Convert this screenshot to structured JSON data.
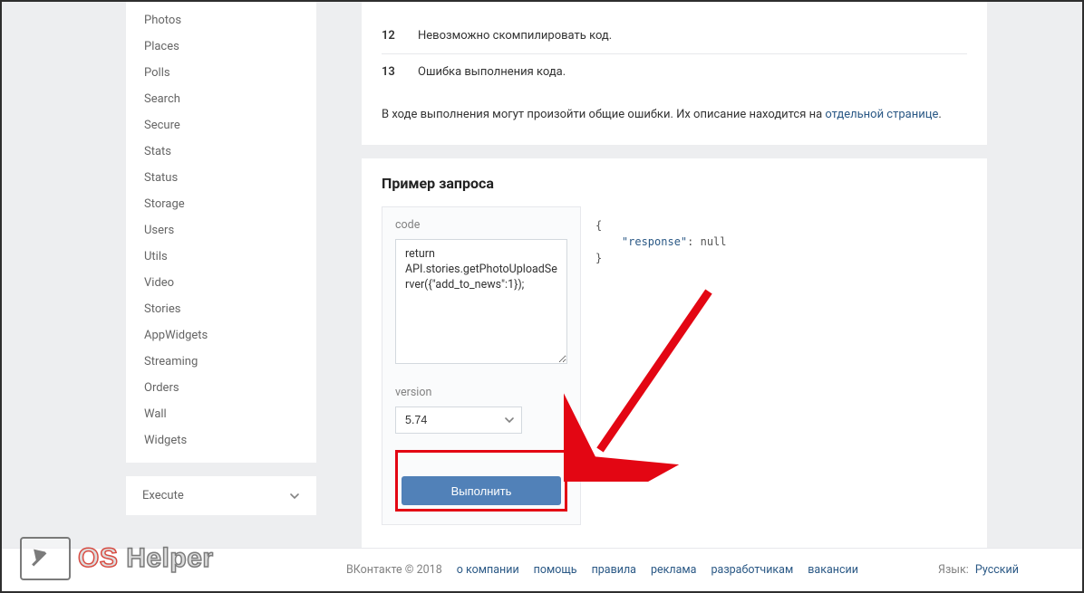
{
  "sidebar": {
    "items": [
      "Photos",
      "Places",
      "Polls",
      "Search",
      "Secure",
      "Stats",
      "Status",
      "Storage",
      "Users",
      "Utils",
      "Video",
      "Stories",
      "AppWidgets",
      "Streaming",
      "Orders",
      "Wall",
      "Widgets"
    ],
    "execute_label": "Execute"
  },
  "errors": {
    "rows": [
      {
        "code": "12",
        "msg": "Невозможно скомпилировать код."
      },
      {
        "code": "13",
        "msg": "Ошибка выполнения кода."
      }
    ],
    "note_prefix": "В ходе выполнения могут произойти общие ошибки. Их описание находится на ",
    "note_link": "отдельной странице",
    "note_suffix": "."
  },
  "example": {
    "title": "Пример запроса",
    "code_label": "code",
    "code_value": "return API.stories.getPhotoUploadServer({\"add_to_news\":1});",
    "version_label": "version",
    "version_value": "5.74",
    "exec_label": "Выполнить",
    "response_line1": "{",
    "response_key": "\"response\"",
    "response_sep": ": ",
    "response_val": "null",
    "response_line3": "}"
  },
  "footer": {
    "copyright": "ВКонтакте © 2018",
    "links": [
      "о компании",
      "помощь",
      "правила",
      "реклама",
      "разработчикам",
      "вакансии"
    ],
    "lang_label": "Язык:",
    "lang_value": "Русский"
  },
  "watermark": {
    "os": "OS",
    "helper": "Helper"
  }
}
